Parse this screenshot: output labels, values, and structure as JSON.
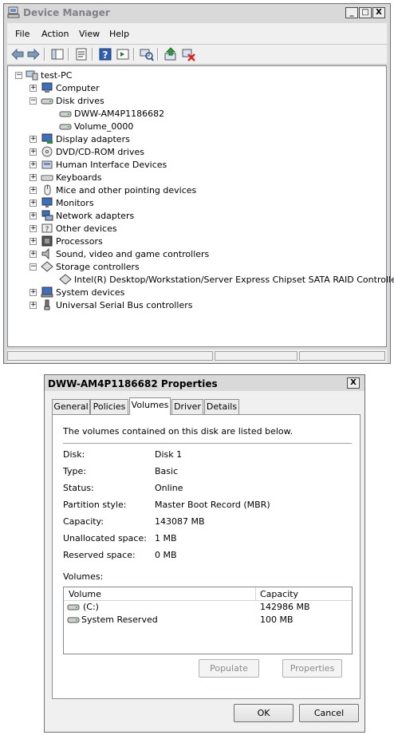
{
  "device_manager": {
    "title": "Device Manager",
    "window_buttons": {
      "minimize": "_",
      "maximize": "□",
      "close": "X"
    },
    "menu": [
      "File",
      "Action",
      "View",
      "Help"
    ],
    "toolbar_icons": [
      "back-arrow-icon",
      "forward-arrow-icon",
      "show-hide-console-tree-icon",
      "properties-icon",
      "help-icon",
      "action-pane-icon",
      "scan-hardware-icon",
      "update-driver-icon",
      "uninstall-icon"
    ],
    "tree": {
      "root": "test-PC",
      "items": [
        {
          "label": "Computer",
          "icon": "computer-icon",
          "expanded": false
        },
        {
          "label": "Disk drives",
          "icon": "disk-drive-icon",
          "expanded": true,
          "children": [
            {
              "label": "DWW-AM4P1186682",
              "icon": "disk-drive-icon"
            },
            {
              "label": "Volume_0000",
              "icon": "disk-drive-icon"
            }
          ]
        },
        {
          "label": "Display adapters",
          "icon": "display-adapter-icon",
          "expanded": false
        },
        {
          "label": "DVD/CD-ROM drives",
          "icon": "dvd-drive-icon",
          "expanded": false
        },
        {
          "label": "Human Interface Devices",
          "icon": "hid-icon",
          "expanded": false
        },
        {
          "label": "Keyboards",
          "icon": "keyboard-icon",
          "expanded": false
        },
        {
          "label": "Mice and other pointing devices",
          "icon": "mouse-icon",
          "expanded": false
        },
        {
          "label": "Monitors",
          "icon": "monitor-icon",
          "expanded": false
        },
        {
          "label": "Network adapters",
          "icon": "network-adapter-icon",
          "expanded": false
        },
        {
          "label": "Other devices",
          "icon": "other-devices-icon",
          "expanded": false
        },
        {
          "label": "Processors",
          "icon": "processor-icon",
          "expanded": false
        },
        {
          "label": "Sound, video and game controllers",
          "icon": "sound-icon",
          "expanded": false
        },
        {
          "label": "Storage controllers",
          "icon": "storage-controller-icon",
          "expanded": true,
          "children": [
            {
              "label": "Intel(R) Desktop/Workstation/Server Express Chipset SATA RAID Controller",
              "icon": "storage-controller-icon"
            }
          ]
        },
        {
          "label": "System devices",
          "icon": "system-devices-icon",
          "expanded": false
        },
        {
          "label": "Universal Serial Bus controllers",
          "icon": "usb-icon",
          "expanded": false
        }
      ]
    }
  },
  "properties": {
    "title": "DWW-AM4P1186682 Properties",
    "close": "X",
    "tabs": [
      "General",
      "Policies",
      "Volumes",
      "Driver",
      "Details"
    ],
    "active_tab": "Volumes",
    "description": "The volumes contained on this disk are listed below.",
    "info": [
      {
        "label": "Disk:",
        "value": "Disk 1"
      },
      {
        "label": "Type:",
        "value": "Basic"
      },
      {
        "label": "Status:",
        "value": "Online"
      },
      {
        "label": "Partition style:",
        "value": "Master Boot Record (MBR)"
      },
      {
        "label": "Capacity:",
        "value": "143087 MB"
      },
      {
        "label": "Unallocated space:",
        "value": "1 MB"
      },
      {
        "label": "Reserved space:",
        "value": "0 MB"
      }
    ],
    "volumes_label": "Volumes:",
    "volume_columns": [
      "Volume",
      "Capacity"
    ],
    "volumes": [
      {
        "name": "(C:)",
        "capacity": "142986 MB"
      },
      {
        "name": "System Reserved",
        "capacity": "100 MB"
      }
    ],
    "populate_button": "Populate",
    "properties_button": "Properties",
    "ok_button": "OK",
    "cancel_button": "Cancel"
  }
}
